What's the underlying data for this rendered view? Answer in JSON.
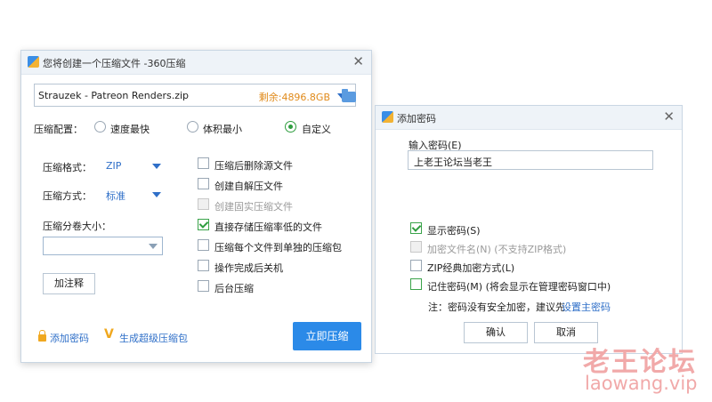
{
  "compress_window": {
    "title": "您将创建一个压缩文件 -360压缩",
    "file_name": "Strauzek - Patreon Renders.zip",
    "free_space": "剩余:4896.8GB",
    "config_label": "压缩配置：",
    "config_options": [
      "速度最快",
      "体积最小",
      "自定义"
    ],
    "format_label": "压缩格式：",
    "format_value": "ZIP",
    "method_label": "压缩方式：",
    "method_value": "标准",
    "split_label": "压缩分卷大小：",
    "split_value": "",
    "comment_button": "加注释",
    "options": [
      {
        "label": "压缩后删除源文件",
        "checked": false,
        "disabled": false
      },
      {
        "label": "创建自解压文件",
        "checked": false,
        "disabled": false
      },
      {
        "label": "创建固实压缩文件",
        "checked": false,
        "disabled": true
      },
      {
        "label": "直接存储压缩率低的文件",
        "checked": true,
        "disabled": false
      },
      {
        "label": "压缩每个文件到单独的压缩包",
        "checked": false,
        "disabled": false
      },
      {
        "label": "操作完成后关机",
        "checked": false,
        "disabled": false
      },
      {
        "label": "后台压缩",
        "checked": false,
        "disabled": false
      }
    ],
    "add_password_link": "添加密码",
    "super_package_link": "生成超级压缩包",
    "compress_button": "立即压缩"
  },
  "password_window": {
    "title": "添加密码",
    "input_label": "输入密码(E)",
    "password_value": "上老王论坛当老王",
    "show_password": "显示密码(S)",
    "encrypt_names": "加密文件名(N) (不支持ZIP格式)",
    "zip_classic": "ZIP经典加密方式(L)",
    "remember_password": "记住密码(M) (将会显示在管理密码窗口中)",
    "note_prefix": "注：密码没有安全加密，建议先",
    "note_link": "设置主密码",
    "ok_button": "确认",
    "cancel_button": "取消"
  },
  "watermark": {
    "title": "老王论坛",
    "url": "laowang.vip"
  },
  "colors": {
    "accent": "#2b8ae8",
    "link": "#2f6fc8",
    "free_space": "#e08a1a",
    "watermark": "#f1a9a9"
  }
}
